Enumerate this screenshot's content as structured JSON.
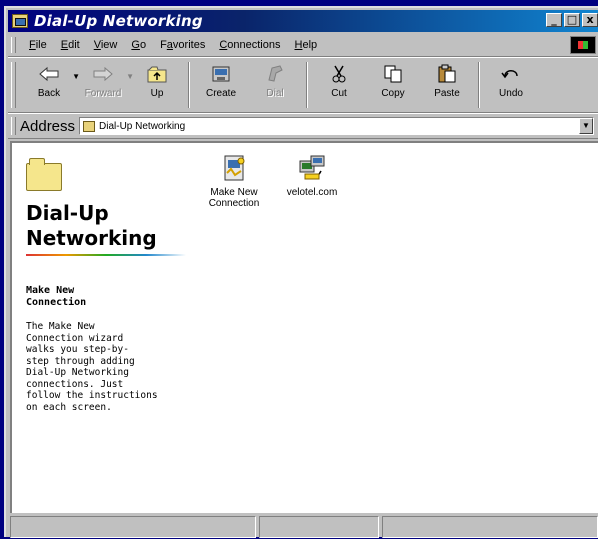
{
  "window": {
    "title": "Dial-Up Networking"
  },
  "title_buttons": {
    "minimize": "_",
    "maximize": "□",
    "close": "x"
  },
  "menu": [
    {
      "label": "File",
      "key": "F",
      "rest": "ile"
    },
    {
      "label": "Edit",
      "key": "E",
      "rest": "dit"
    },
    {
      "label": "View",
      "key": "V",
      "rest": "iew"
    },
    {
      "label": "Go",
      "key": "G",
      "rest": "o"
    },
    {
      "label": "Favorites",
      "key": "a",
      "pre": "F",
      "rest": "vorites"
    },
    {
      "label": "Connections",
      "key": "C",
      "rest": "onnections"
    },
    {
      "label": "Help",
      "key": "H",
      "rest": "elp"
    }
  ],
  "toolbar": {
    "back": "Back",
    "forward": "Forward",
    "up": "Up",
    "create": "Create",
    "dial": "Dial",
    "cut": "Cut",
    "copy": "Copy",
    "paste": "Paste",
    "undo": "Undo"
  },
  "address": {
    "label": "Address",
    "value": "Dial-Up Networking"
  },
  "left_pane": {
    "title_line1": "Dial-Up",
    "title_line2": "Networking",
    "subtitle_line1": "Make New",
    "subtitle_line2": "Connection",
    "description": [
      "The Make New",
      "Connection wizard",
      "walks you step-by-",
      "step through adding",
      "Dial-Up Networking",
      "connections. Just",
      "follow the instructions",
      "on each screen."
    ]
  },
  "icons": [
    {
      "line1": "Make New",
      "line2": "Connection"
    },
    {
      "line1": "velotel.com",
      "line2": ""
    }
  ],
  "colors": {
    "title_bar": "#000080",
    "face": "#c0c0c0",
    "content_bg": "#ffffff"
  }
}
